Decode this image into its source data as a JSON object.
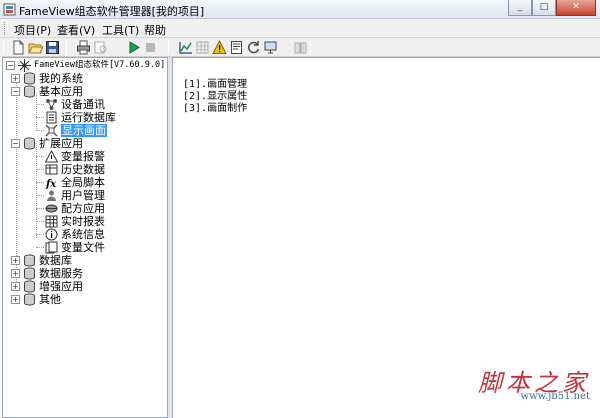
{
  "window": {
    "title": "FameView组态软件管理器[我的项目]",
    "minimize": "_",
    "maximize": "□",
    "close": "✕"
  },
  "menu": [
    "项目(P)",
    "查看(V)",
    "工具(T)",
    "帮助"
  ],
  "toolbar_icons": [
    "new-file-icon",
    "open-folder-icon",
    "save-icon",
    "print-icon",
    "print-preview-icon",
    "run-icon",
    "stop-icon",
    "chart-icon",
    "grid-icon",
    "warning-icon",
    "document-icon",
    "refresh-icon",
    "computer-icon",
    "book-icon"
  ],
  "tree": {
    "root": "FameView组态软件[V7.60.9.0]",
    "nodes": [
      {
        "label": "我的系统",
        "level": 1,
        "expander": "+"
      },
      {
        "label": "基本应用",
        "level": 1,
        "expander": "-"
      },
      {
        "label": "设备通讯",
        "level": 2
      },
      {
        "label": "运行数据库",
        "level": 2
      },
      {
        "label": "显示画面",
        "level": 2,
        "selected": true
      },
      {
        "label": "扩展应用",
        "level": 1,
        "expander": "-"
      },
      {
        "label": "变量报警",
        "level": 2
      },
      {
        "label": "历史数据",
        "level": 2
      },
      {
        "label": "全局脚本",
        "level": 2
      },
      {
        "label": "用户管理",
        "level": 2
      },
      {
        "label": "配方应用",
        "level": 2
      },
      {
        "label": "实时报表",
        "level": 2
      },
      {
        "label": "系统信息",
        "level": 2
      },
      {
        "label": "变量文件",
        "level": 2
      },
      {
        "label": "数据库",
        "level": 1,
        "expander": "+"
      },
      {
        "label": "数据服务",
        "level": 1,
        "expander": "+"
      },
      {
        "label": "增强应用",
        "level": 1,
        "expander": "+"
      },
      {
        "label": "其他",
        "level": 1,
        "expander": "+"
      }
    ]
  },
  "content": {
    "lines": [
      "[1].画面管理",
      "[2].显示属性",
      "[3].画面制作"
    ]
  },
  "watermark": {
    "big": "脚本之家",
    "small": "www.jb51.net"
  },
  "colors": {
    "selection": "#3399ff",
    "watermark_red": "#c3323a",
    "watermark_blue": "#3e6aa0"
  }
}
